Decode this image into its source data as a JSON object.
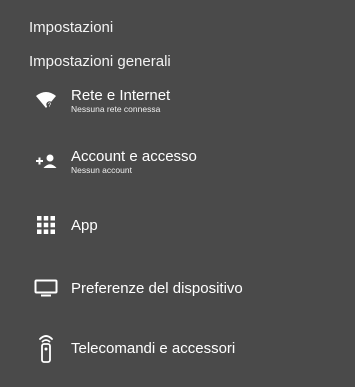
{
  "header": {
    "title": "Impostazioni",
    "section": "Impostazioni generali"
  },
  "items": [
    {
      "icon": "wifi-icon",
      "label": "Rete e Internet",
      "sublabel": "Nessuna rete connessa"
    },
    {
      "icon": "add-account-icon",
      "label": "Account e accesso",
      "sublabel": "Nessun account"
    },
    {
      "icon": "apps-grid-icon",
      "label": "App",
      "sublabel": ""
    },
    {
      "icon": "tv-icon",
      "label": "Preferenze del dispositivo",
      "sublabel": ""
    },
    {
      "icon": "remote-icon",
      "label": "Telecomandi e accessori",
      "sublabel": ""
    }
  ],
  "colors": {
    "background": "#4a4a4a",
    "text": "#ffffff"
  }
}
